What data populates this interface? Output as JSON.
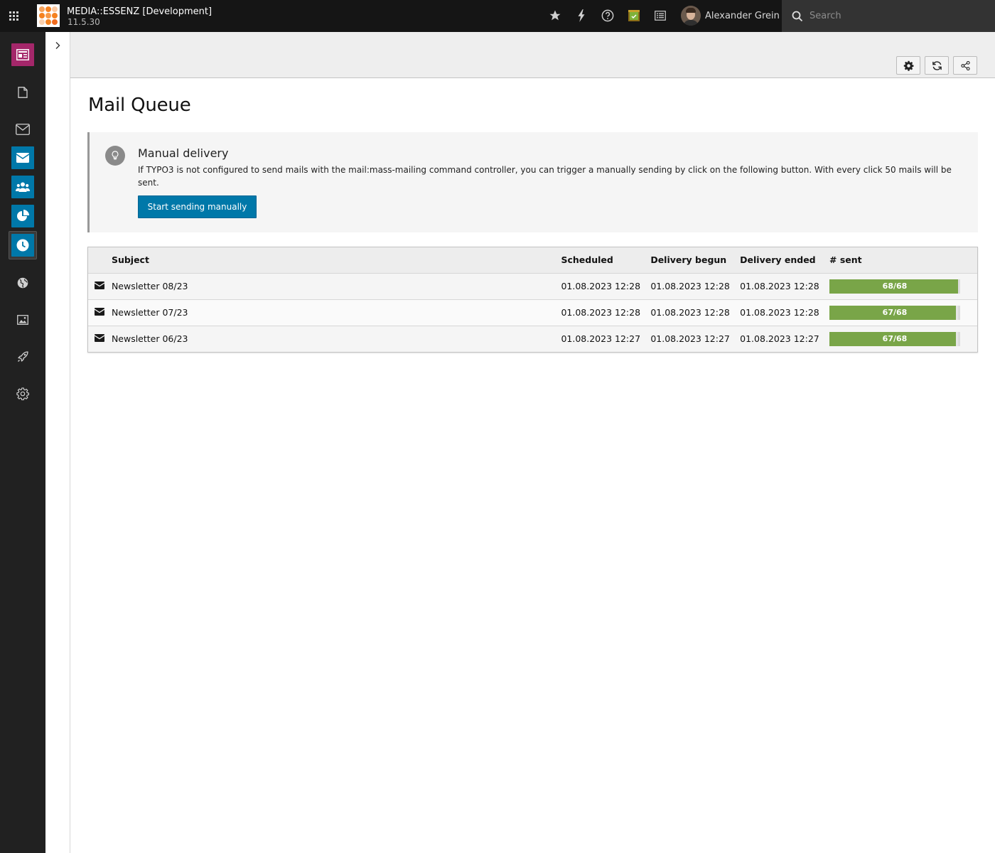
{
  "topbar": {
    "site_name": "MEDIA::ESSENZ [Development]",
    "site_version": "11.5.30",
    "user_name": "Alexander Grein",
    "search_placeholder": "Search",
    "logo_colors": [
      "#f7a35c",
      "#f58220",
      "#fbc8a0",
      "#f58220",
      "#f79a4a",
      "#f58220",
      "#fbd0ae",
      "#f58220",
      "#f26b1d"
    ]
  },
  "module_menu": {
    "items": [
      {
        "name": "web-module",
        "icon": "layout-icon",
        "color": "#a4276a"
      },
      {
        "name": "page-module",
        "icon": "page-icon",
        "color": null
      },
      {
        "name": "mail-module",
        "icon": "envelope-outline-icon",
        "color": null
      },
      {
        "name": "mail-wizard-module",
        "icon": "envelope-icon",
        "color": "#0078a9"
      },
      {
        "name": "recipients-module",
        "icon": "users-icon",
        "color": "#0078a9"
      },
      {
        "name": "reports-module",
        "icon": "pie-chart-icon",
        "color": "#0078a9"
      },
      {
        "name": "queue-module",
        "icon": "clock-icon",
        "color": "#0078a9"
      },
      {
        "name": "sites-module",
        "icon": "globe-icon",
        "color": null
      },
      {
        "name": "filelist-module",
        "icon": "image-icon",
        "color": null
      },
      {
        "name": "extensions-module",
        "icon": "rocket-icon",
        "color": null
      },
      {
        "name": "settings-module",
        "icon": "gear-icon",
        "color": null
      }
    ]
  },
  "main": {
    "title": "Mail Queue",
    "callout": {
      "title": "Manual delivery",
      "text": "If TYPO3 is not configured to send mails with the mail:mass-mailing command controller, you can trigger a manually sending by click on the following button. With every click 50 mails will be sent.",
      "button_label": "Start sending manually"
    },
    "table": {
      "headers": {
        "subject": "Subject",
        "scheduled": "Scheduled",
        "begun": "Delivery begun",
        "ended": "Delivery ended",
        "sent": "# sent"
      },
      "rows": [
        {
          "subject": "Newsletter 08/23",
          "scheduled": "01.08.2023 12:28",
          "begun": "01.08.2023 12:28",
          "ended": "01.08.2023 12:28",
          "sent_label": "68/68",
          "sent": 68,
          "total": 68
        },
        {
          "subject": "Newsletter 07/23",
          "scheduled": "01.08.2023 12:28",
          "begun": "01.08.2023 12:28",
          "ended": "01.08.2023 12:28",
          "sent_label": "67/68",
          "sent": 67,
          "total": 68
        },
        {
          "subject": "Newsletter 06/23",
          "scheduled": "01.08.2023 12:27",
          "begun": "01.08.2023 12:27",
          "ended": "01.08.2023 12:27",
          "sent_label": "67/68",
          "sent": 67,
          "total": 68
        }
      ]
    }
  },
  "colors": {
    "topbar_bg": "#151515",
    "module_menu_bg": "#212121",
    "primary": "#0078a9",
    "progress": "#79a548"
  }
}
